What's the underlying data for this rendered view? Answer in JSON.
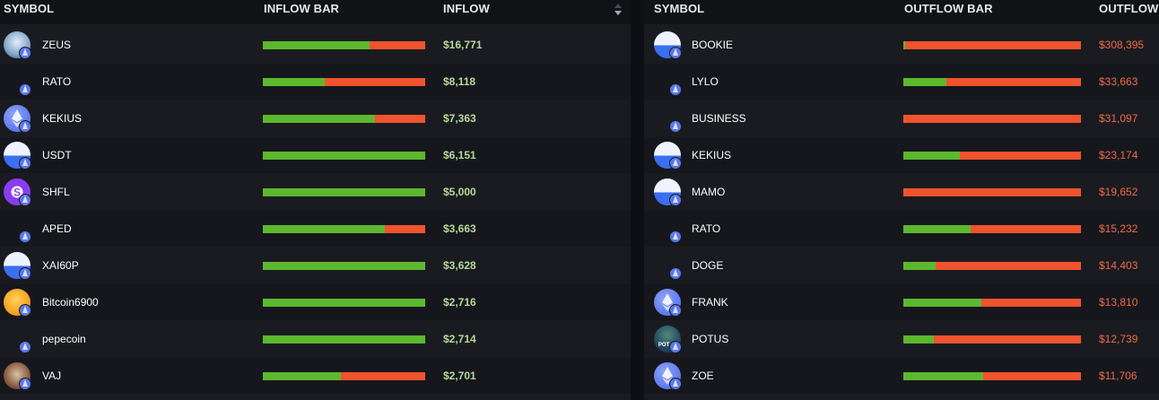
{
  "inflow_table": {
    "headers": {
      "symbol": "SYMBOL",
      "bar": "INFLOW BAR",
      "value": "INFLOW"
    },
    "rows": [
      {
        "symbol": "ZEUS",
        "value": "$16,771",
        "inflow_share": 0.66,
        "icon": "zeus-avatar-icon"
      },
      {
        "symbol": "RATO",
        "value": "$8,118",
        "inflow_share": 0.38,
        "icon": "token-icon"
      },
      {
        "symbol": "KEKIUS",
        "value": "$7,363",
        "inflow_share": 0.69,
        "icon": "ethereum-icon"
      },
      {
        "symbol": "USDT",
        "value": "$6,151",
        "inflow_share": 1.0,
        "icon": "half-circle-token-icon"
      },
      {
        "symbol": "SHFL",
        "value": "$5,000",
        "inflow_share": 1.0,
        "icon": "shfl-chip-icon"
      },
      {
        "symbol": "APED",
        "value": "$3,663",
        "inflow_share": 0.75,
        "icon": "token-icon"
      },
      {
        "symbol": "XAI60P",
        "value": "$3,628",
        "inflow_share": 1.0,
        "icon": "half-circle-token-icon"
      },
      {
        "symbol": "Bitcoin6900",
        "value": "$2,716",
        "inflow_share": 1.0,
        "icon": "bitcoin6900-icon"
      },
      {
        "symbol": "pepecoin",
        "value": "$2,714",
        "inflow_share": 1.0,
        "icon": "token-icon"
      },
      {
        "symbol": "VAJ",
        "value": "$2,701",
        "inflow_share": 0.48,
        "icon": "vaj-avatar-icon"
      }
    ]
  },
  "outflow_table": {
    "headers": {
      "symbol": "SYMBOL",
      "bar": "OUTFLOW BAR",
      "value": "OUTFLOW"
    },
    "rows": [
      {
        "symbol": "BOOKIE",
        "value": "$308,395",
        "inflow_share": 0.01,
        "icon": "half-circle-token-icon"
      },
      {
        "symbol": "LYLO",
        "value": "$33,663",
        "inflow_share": 0.24,
        "icon": "token-icon"
      },
      {
        "symbol": "BUSINESS",
        "value": "$31,097",
        "inflow_share": 0.0,
        "icon": "token-icon"
      },
      {
        "symbol": "KEKIUS",
        "value": "$23,174",
        "inflow_share": 0.32,
        "icon": "half-circle-token-icon"
      },
      {
        "symbol": "MAMO",
        "value": "$19,652",
        "inflow_share": 0.0,
        "icon": "half-circle-token-icon"
      },
      {
        "symbol": "RATO",
        "value": "$15,232",
        "inflow_share": 0.38,
        "icon": "token-icon"
      },
      {
        "symbol": "DOGE",
        "value": "$14,403",
        "inflow_share": 0.18,
        "icon": "token-icon"
      },
      {
        "symbol": "FRANK",
        "value": "$13,810",
        "inflow_share": 0.44,
        "icon": "ethereum-icon"
      },
      {
        "symbol": "POTUS",
        "value": "$12,739",
        "inflow_share": 0.17,
        "icon": "potus-avatar-icon"
      },
      {
        "symbol": "ZOE",
        "value": "$11,706",
        "inflow_share": 0.45,
        "icon": "ethereum-icon"
      }
    ]
  },
  "colors": {
    "inflow": "#5cb82e",
    "outflow": "#f0532d",
    "inflow_text": "#b7d99a",
    "outflow_text": "#ef6a48",
    "eth_badge": "#5b78ee"
  }
}
